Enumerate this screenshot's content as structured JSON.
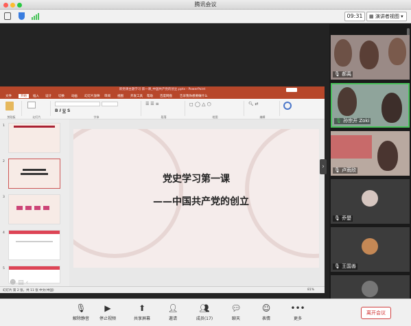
{
  "app": {
    "title": "腾讯会议"
  },
  "toolbar": {
    "time": "09:31",
    "view_label": "演讲者视图"
  },
  "ppt": {
    "window_title": "新党课主题学习 第一课_中国共产党的创立.pptx - PowerPoint",
    "ribbon_tabs": [
      "文件",
      "开始",
      "插入",
      "设计",
      "切换",
      "动画",
      "幻灯片放映",
      "审阅",
      "视图",
      "开发工具",
      "帮助",
      "百度网盘",
      "告诉我你想要做什么"
    ],
    "groups": [
      "剪贴板",
      "幻灯片",
      "字体",
      "段落",
      "绘图",
      "编辑"
    ],
    "thumbnails": [
      "1",
      "2",
      "3",
      "4",
      "5"
    ],
    "slide": {
      "line1": "党史学习第一课",
      "line2": "——中国共产党的创立"
    },
    "status_left": "幻灯片 第 2 张，共 11 张   中文(中国)",
    "zoom": "81%"
  },
  "participants": [
    {
      "name": "郝禹"
    },
    {
      "name": "孙宗开 Zoki"
    },
    {
      "name": "卢雨欣"
    },
    {
      "name": "乔楚"
    },
    {
      "name": "王国善"
    },
    {
      "name": ""
    }
  ],
  "bottom": {
    "mute": "解除静音",
    "video": "停止视频",
    "share": "共享屏幕",
    "invite": "邀请",
    "members": "成员(17)",
    "chat": "聊天",
    "reactions": "表情",
    "more": "更多",
    "leave": "离开会议"
  },
  "colors": {
    "ppt_red": "#b7472a",
    "accent_green": "#48c35a"
  }
}
